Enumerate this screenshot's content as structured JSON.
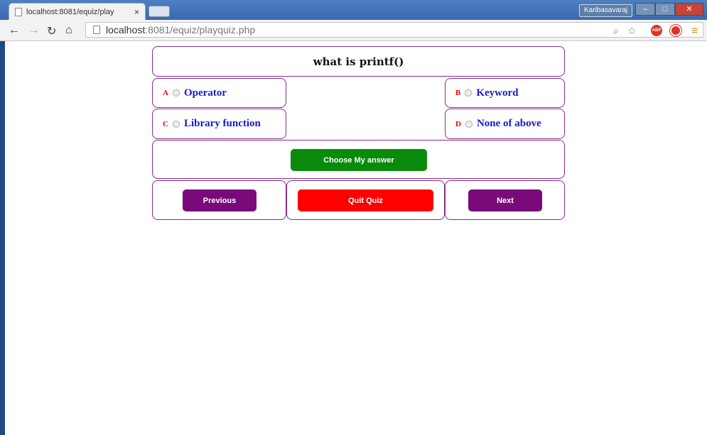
{
  "browser": {
    "tab_title": "localhost:8081/equiz/play",
    "tab_close": "×",
    "user": "Karibasavaraj",
    "window_controls": {
      "minimize": "–",
      "maximize": "□",
      "close": "✕"
    },
    "url_host": "localhost",
    "url_path": ":8081/equiz/playquiz.php",
    "abp_label": "ABP",
    "icons": [
      "back-icon",
      "forward-icon",
      "reload-icon",
      "home-icon",
      "zoom-icon",
      "star-icon",
      "adblock-icon",
      "stop-icon",
      "menu-icon"
    ]
  },
  "quiz": {
    "question": "what is printf()",
    "options": [
      {
        "letter": "A",
        "text": "Operator"
      },
      {
        "letter": "B",
        "text": "Keyword"
      },
      {
        "letter": "C",
        "text": "Library function"
      },
      {
        "letter": "D",
        "text": "None of above"
      }
    ],
    "choose_label": "Choose My answer",
    "previous_label": "Previous",
    "quit_label": "Quit Quiz",
    "next_label": "Next"
  },
  "colors": {
    "border": "#8a2b8a",
    "option_text": "#1a1ad0",
    "option_letter": "#e00000",
    "choose_button": "#0a8a0a",
    "nav_button": "#7a0a7a",
    "quit_button": "#ff0000"
  }
}
